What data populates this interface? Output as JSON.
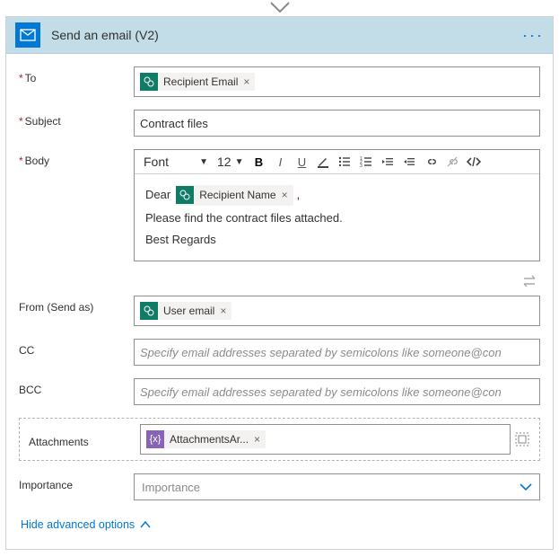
{
  "arrow_hint": "",
  "header": {
    "title": "Send an email (V2)",
    "menu": "···"
  },
  "fields": {
    "to": {
      "label": "To",
      "token": "Recipient Email"
    },
    "subject": {
      "label": "Subject",
      "value": "Contract files"
    },
    "body": {
      "label": "Body",
      "font_label": "Font",
      "size_label": "12",
      "greeting_prefix": "Dear",
      "greeting_token": "Recipient Name",
      "greeting_suffix": ",",
      "line2": "Please find the contract files attached.",
      "line3": "Best Regards"
    },
    "from": {
      "label": "From (Send as)",
      "token": "User email"
    },
    "cc": {
      "label": "CC",
      "placeholder": "Specify email addresses separated by semicolons like someone@con"
    },
    "bcc": {
      "label": "BCC",
      "placeholder": "Specify email addresses separated by semicolons like someone@con"
    },
    "attachments": {
      "label": "Attachments",
      "token": "AttachmentsAr...",
      "token_icon": "{x}"
    },
    "importance": {
      "label": "Importance",
      "placeholder": "Importance"
    }
  },
  "advanced_link": "Hide advanced options"
}
